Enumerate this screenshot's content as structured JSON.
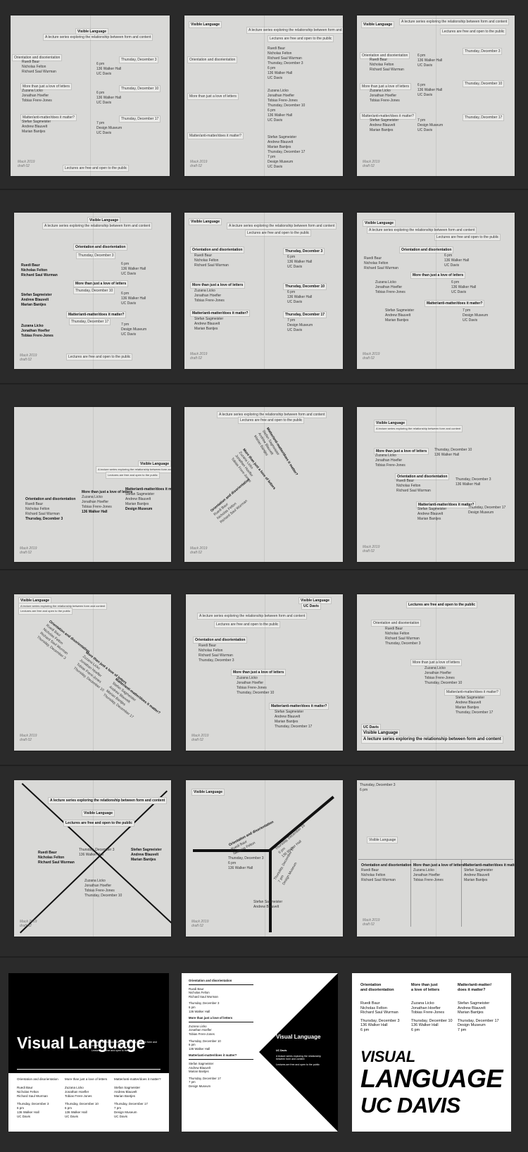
{
  "drafts": {
    "title": "Visible Language",
    "tagline": "A lecture series exploring the relationship between form and content",
    "public_note": "Lectures are free and open to the public",
    "campus": "UC Davis",
    "sessions": [
      {
        "title": "Orientation and disorientation",
        "date": "Thursday, December 3",
        "speakers": [
          "Ruedi Baur",
          "Nicholas Felton",
          "Richard Saul Wurman"
        ],
        "time": "6 pm",
        "place": "136 Walker Hall",
        "campus": "UC Davis"
      },
      {
        "title": "More than just a love of letters",
        "date": "Thursday, December 10",
        "speakers": [
          "Zuzana Licko",
          "Jonathan Hoefler",
          "Tobias Frere-Jones"
        ],
        "time": "6 pm",
        "place": "136 Walker Hall",
        "campus": "UC Davis"
      },
      {
        "title": "Matter/anti-matter/does it matter?",
        "date": "Thursday, December 17",
        "speakers": [
          "Stefan Sagmeister",
          "Andrew Blauvelt",
          "Marian Bantjes"
        ],
        "time": "7 pm",
        "place": "Design Museum",
        "campus": "UC Davis"
      }
    ],
    "pencil_note": "Mack 2019 draft 02",
    "visual_language": "Visual Language",
    "big_title_1": "VISUAL",
    "big_title_2": "LANGUAGE",
    "big_title_3": "UC DAVIS",
    "final_head_1a": "Orientation",
    "final_head_1b": "and disorientation",
    "final_head_2a": "More than just",
    "final_head_2b": "a love of letters",
    "final_head_3a": "Matter/anti-matter/",
    "final_head_3b": "does it matter?",
    "final_time_3": "7 pm",
    "final_time_1": "6 pm",
    "final_time_2": "6 pm",
    "final_dm": "Design Museum",
    "final_uc": "UC Davis",
    "final_wh": "136 Walker Hall"
  },
  "colors": {
    "background": "#2a2a2a",
    "paper": "#d9d9d7",
    "strip": "#ececea",
    "ink": "#111111",
    "final_black": "#000000",
    "final_white": "#ffffff"
  }
}
